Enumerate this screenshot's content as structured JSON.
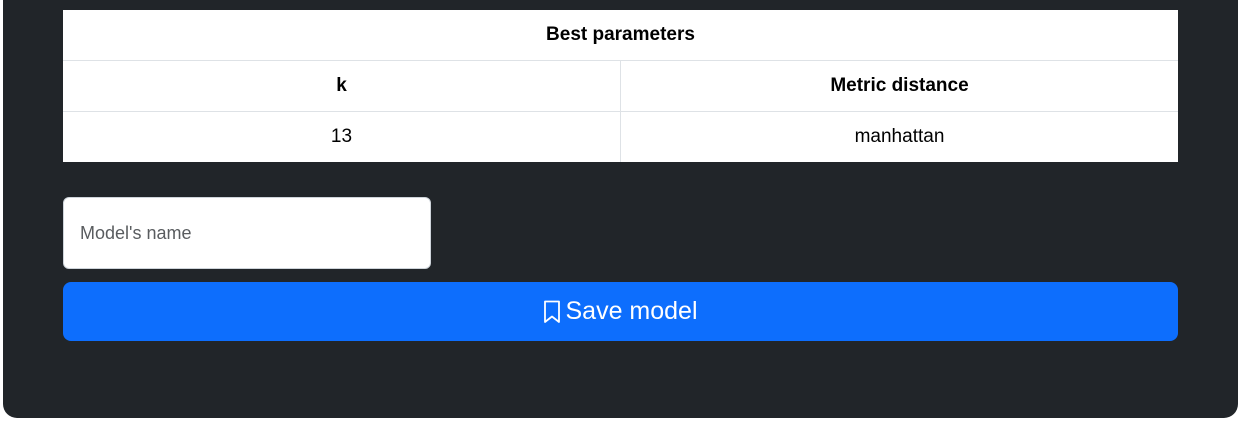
{
  "best_params_table": {
    "caption": "Best parameters",
    "headers": [
      "k",
      "Metric distance"
    ],
    "rows": [
      [
        "13",
        "manhattan"
      ]
    ]
  },
  "model_name_input": {
    "value": "",
    "placeholder": "Model's name"
  },
  "save_button": {
    "label": "Save model",
    "icon": "bookmark-icon"
  },
  "colors": {
    "panel_background": "#212529",
    "primary": "#0d6efd",
    "table_background": "#ffffff",
    "table_border": "#dee2e6"
  }
}
